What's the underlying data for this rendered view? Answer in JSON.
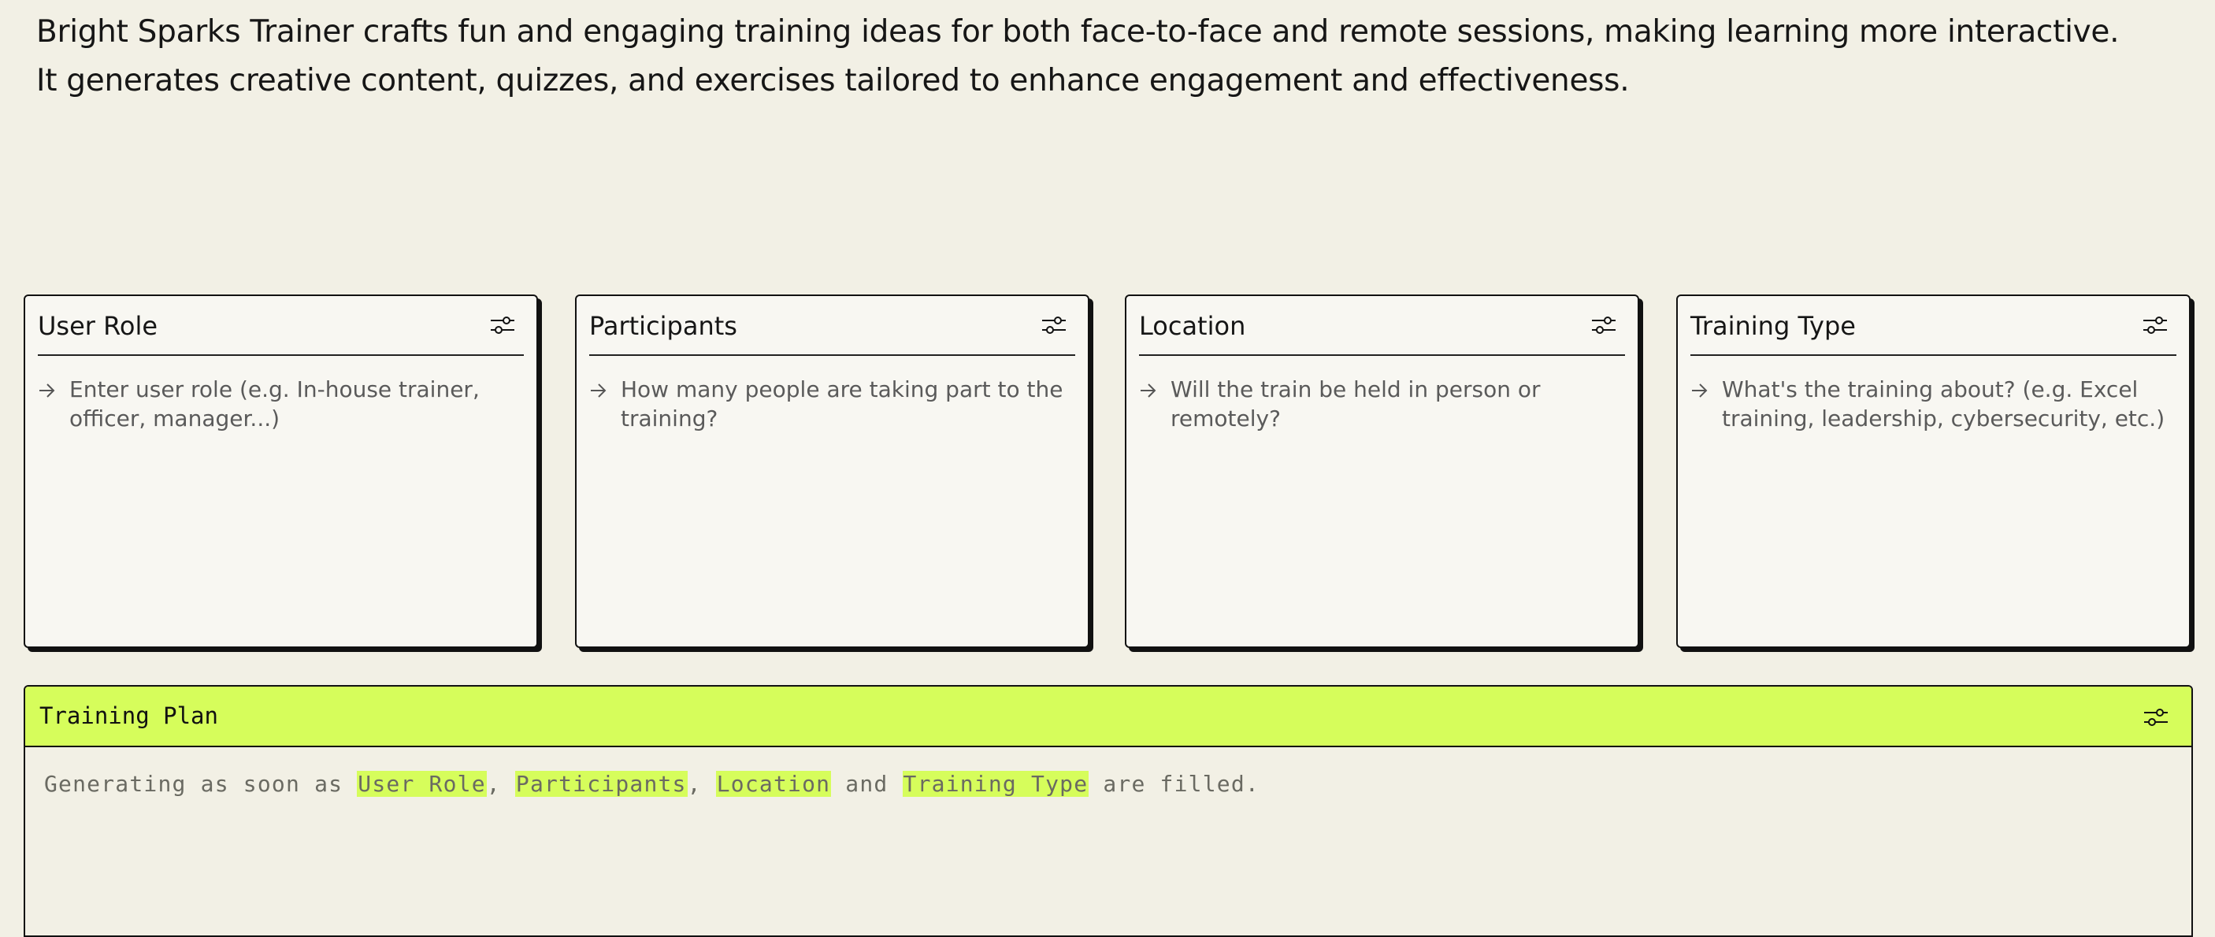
{
  "intro": "Bright Sparks Trainer crafts fun and engaging training ideas for both face-to-face and remote sessions, making learning more interactive. It generates creative content, quizzes, and exercises tailored to enhance engagement and effectiveness.",
  "cards": [
    {
      "title": "User Role",
      "prompt": "Enter user role (e.g. In-house trainer, officer, manager...)"
    },
    {
      "title": "Participants",
      "prompt": "How many people are taking part to the training?"
    },
    {
      "title": "Location",
      "prompt": "Will the train be held in person or remotely?"
    },
    {
      "title": "Training Type",
      "prompt": "What's the training about? (e.g. Excel training, leadership, cybersecurity, etc.)"
    }
  ],
  "plan": {
    "title": "Training Plan",
    "status": {
      "prefix": "Generating as soon as ",
      "field1": "User Role",
      "sep1": ", ",
      "field2": "Participants",
      "sep2": ", ",
      "field3": "Location",
      "conj": " and ",
      "field4": "Training Type",
      "suffix": " are filled."
    }
  },
  "icons": {
    "settings": "sliders-icon",
    "arrow": "arrow-right-icon"
  },
  "colors": {
    "accent": "#d6fd5b",
    "background": "#f2f0e5",
    "card": "#f8f7f2",
    "border": "#111111"
  }
}
